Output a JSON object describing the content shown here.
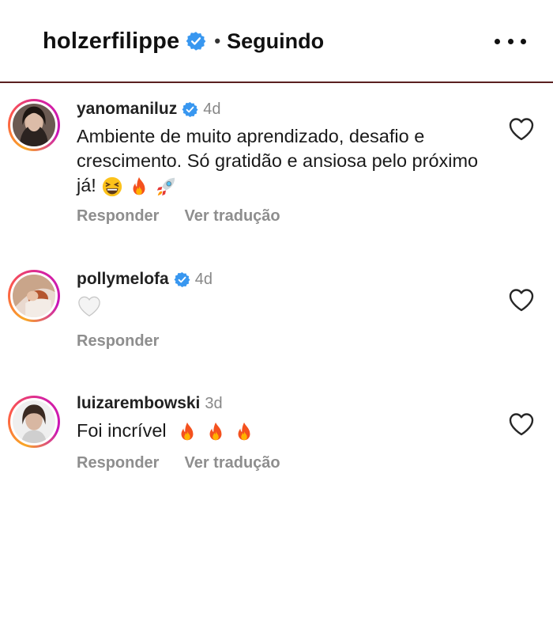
{
  "header": {
    "username": "holzerfilippe",
    "separator": "•",
    "follow_status": "Seguindo"
  },
  "comments": [
    {
      "username": "yanomaniluz",
      "verified": true,
      "time": "4d",
      "text": "Ambiente de muito aprendizado, desafio e crescimento. Só gratidão e ansiosa pelo próximo já!",
      "emojis": [
        "grinning-squinting-face",
        "fire",
        "rocket"
      ],
      "actions": [
        "Responder",
        "Ver tradução"
      ]
    },
    {
      "username": "pollymelofa",
      "verified": true,
      "time": "4d",
      "text": "",
      "emojis": [
        "white-heart"
      ],
      "actions": [
        "Responder"
      ]
    },
    {
      "username": "luizarembowski",
      "verified": false,
      "time": "3d",
      "text": "Foi incrível",
      "emojis": [
        "fire",
        "fire",
        "fire"
      ],
      "actions": [
        "Responder",
        "Ver tradução"
      ]
    }
  ],
  "colors": {
    "verified_blue": "#3897f0",
    "divider": "#5a1f1f",
    "muted_text": "#8e8e8e"
  }
}
